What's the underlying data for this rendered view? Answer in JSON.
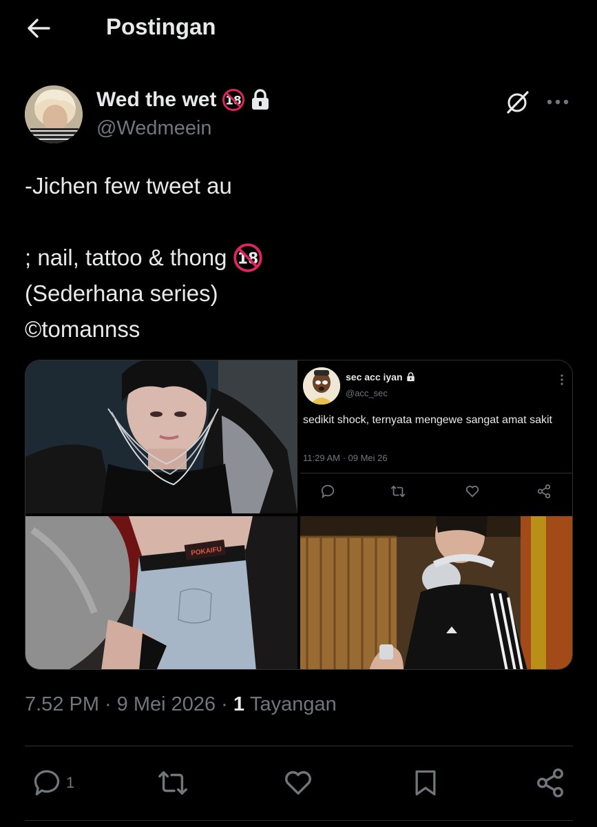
{
  "header": {
    "back_icon": "arrow-left-icon",
    "title": "Postingan"
  },
  "author": {
    "display_name": "Wed the wet",
    "badges": [
      "no-under-18-icon",
      "lock-icon"
    ],
    "handle": "@Wedmeein"
  },
  "tweet": {
    "lines": [
      "-Jichen few tweet au",
      "",
      "; nail, tattoo & thong",
      "(Sederhana series)",
      "©tomannss"
    ],
    "emoji_after_line_3": "no-under-18-icon"
  },
  "media": {
    "embedded_tweet": {
      "display_name": "sec acc iyan",
      "handle": "@acc_sec",
      "text": "sedikit shock, ternyata mengewe sangat amat sakit",
      "timestamp": "11:29 AM · 09 Mei 26"
    },
    "photo_text": "POKAIFU"
  },
  "meta": {
    "time": "7.52 PM",
    "date": "9 Mei 2026",
    "views_count": "1",
    "views_label": "Tayangan"
  },
  "actions": {
    "reply_count": "1"
  },
  "colors": {
    "background": "#000000",
    "text_primary": "#e7e9ea",
    "text_secondary": "#71767b",
    "divider": "#2f3336",
    "badge_red": "#e0245e"
  }
}
